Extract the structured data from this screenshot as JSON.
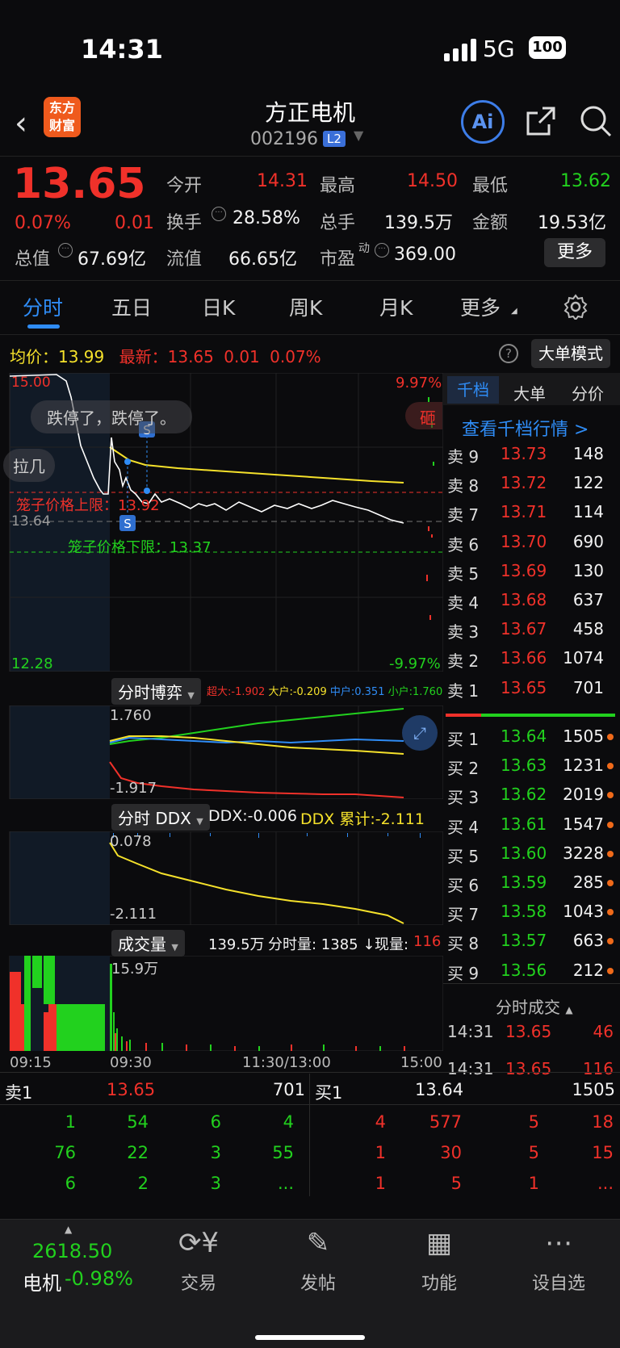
{
  "status": {
    "time": "14:31",
    "network": "5G",
    "battery": "100"
  },
  "nav": {
    "logo_line1": "东方",
    "logo_line2": "财富",
    "stock_name": "方正电机",
    "stock_code": "002196",
    "level": "L2",
    "ai": "Ai"
  },
  "quote": {
    "price": "13.65",
    "change_pct": "0.07%",
    "change": "0.01",
    "open_label": "今开",
    "open": "14.31",
    "high_label": "最高",
    "high": "14.50",
    "low_label": "最低",
    "low": "13.62",
    "turnover_label": "换手",
    "turnover": "28.58%",
    "volume_label": "总手",
    "volume": "139.5万",
    "amount_label": "金额",
    "amount": "19.53亿",
    "mcap_label": "总值",
    "mcap": "67.69亿",
    "float_label": "流值",
    "float": "66.65亿",
    "pe_label": "市盈",
    "pe_sup": "动",
    "pe": "369.00",
    "more": "更多"
  },
  "tabs": [
    "分时",
    "五日",
    "日K",
    "周K",
    "月K",
    "更多"
  ],
  "info": {
    "avg_label": "均价：",
    "avg": "13.99",
    "latest_label": "最新：",
    "latest": "13.65",
    "chg": "0.01",
    "pct": "0.07%",
    "big_order_mode": "大单模式"
  },
  "chart": {
    "top_price": "15.00",
    "top_pct": "9.97%",
    "bottom_price": "12.28",
    "bottom_pct": "-9.97%",
    "ref_price": "13.64",
    "bubble1": "跌停了，跌停了。",
    "bubble2": "拉几",
    "bubble3": "砸",
    "cage_upper": "笼子价格上限：13.92",
    "cage_lower": "笼子价格下限：13.37",
    "xticks": [
      "09:15",
      "09:30",
      "11:30/13:00",
      "15:00"
    ]
  },
  "game": {
    "label": "分时博弈",
    "super": "超大:-1.902",
    "big": "大户:-0.209",
    "mid": "中户:0.351",
    "small": "小户:1.760",
    "max": "1.760",
    "min": "-1.917"
  },
  "ddx": {
    "label": "分时 DDX",
    "ddx": "DDX:-0.006",
    "ddx_cum": "DDX 累计:-2.111",
    "max": "0.078",
    "min": "-2.111"
  },
  "vol": {
    "label": "成交量",
    "total": "139.5万",
    "fen_label": "分时量: 1385 ↓",
    "now_label": "现量:",
    "now": "116",
    "max": "15.9万"
  },
  "book_tabs": [
    "千档",
    "大单",
    "分价"
  ],
  "book_link": "查看千档行情 >",
  "asks": [
    [
      "卖 9",
      "13.73",
      "148"
    ],
    [
      "卖 8",
      "13.72",
      "122"
    ],
    [
      "卖 7",
      "13.71",
      "114"
    ],
    [
      "卖 6",
      "13.70",
      "690"
    ],
    [
      "卖 5",
      "13.69",
      "130"
    ],
    [
      "卖 4",
      "13.68",
      "637"
    ],
    [
      "卖 3",
      "13.67",
      "458"
    ],
    [
      "卖 2",
      "13.66",
      "1074"
    ],
    [
      "卖 1",
      "13.65",
      "701"
    ]
  ],
  "bids": [
    [
      "买 1",
      "13.64",
      "1505"
    ],
    [
      "买 2",
      "13.63",
      "1231"
    ],
    [
      "买 3",
      "13.62",
      "2019"
    ],
    [
      "买 4",
      "13.61",
      "1547"
    ],
    [
      "买 5",
      "13.60",
      "3228"
    ],
    [
      "买 6",
      "13.59",
      "285"
    ],
    [
      "买 7",
      "13.58",
      "1043"
    ],
    [
      "买 8",
      "13.57",
      "663"
    ],
    [
      "买 9",
      "13.56",
      "212"
    ]
  ],
  "ticks_label": "分时成交",
  "ticks": [
    [
      "14:31",
      "13.65",
      "46"
    ],
    [
      "14:31",
      "13.65",
      "116"
    ]
  ],
  "queue": {
    "ask_label": "卖1",
    "ask_price": "13.65",
    "ask_vol": "701",
    "bid_label": "买1",
    "bid_price": "13.64",
    "bid_vol": "1505",
    "ask_rows": [
      [
        "1",
        "54",
        "6",
        "4"
      ],
      [
        "76",
        "22",
        "3",
        "55"
      ],
      [
        "6",
        "2",
        "3",
        "..."
      ]
    ],
    "bid_rows": [
      [
        "4",
        "577",
        "5",
        "18"
      ],
      [
        "1",
        "30",
        "5",
        "15"
      ],
      [
        "1",
        "5",
        "1",
        "..."
      ]
    ]
  },
  "tabbar": {
    "index_value": "2618.50",
    "index_name": "电机",
    "index_pct": "-0.98%",
    "trade": "交易",
    "post": "发帖",
    "func": "功能",
    "fav": "设自选"
  },
  "colors": {
    "up": "#f0312a",
    "down": "#22d11e",
    "accent": "#2f8cf5",
    "avg_line": "#f5e12b"
  }
}
